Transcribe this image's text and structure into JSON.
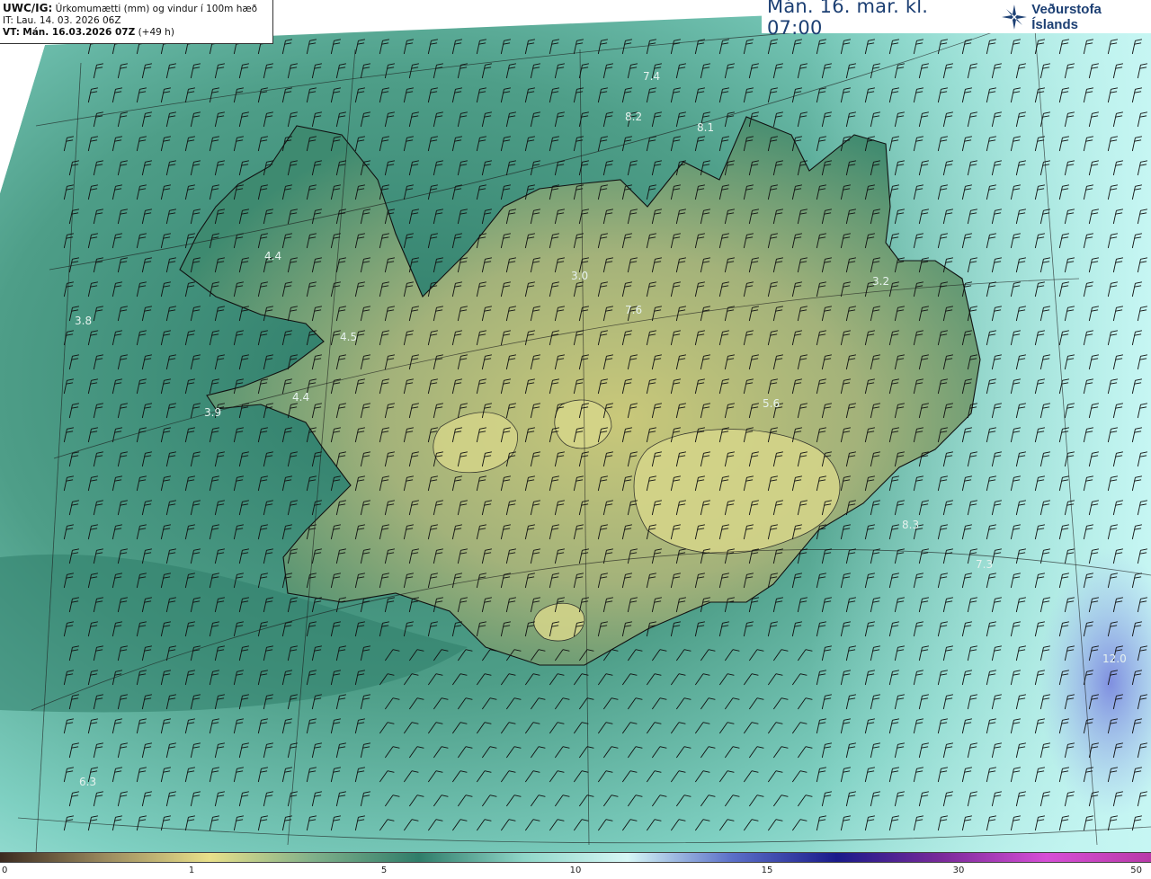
{
  "header": {
    "title_prefix": "UWC/IG:",
    "title_rest": " Úrkomumætti (mm) og vindur í 100m hæð",
    "initial_time": "IT: Lau. 14. 03. 2026 06Z",
    "valid_prefix": "VT:",
    "valid_time": "Mán. 16.03.2026 07Z",
    "lead": "(+49 h)",
    "date_display": "Mán. 16. mar. kl. 07:00",
    "brand": "Veðurstofa Íslands"
  },
  "colors": {
    "land_low": "#2f7d6a",
    "land_high": "#c9c87a",
    "sea": "#7fd0c2",
    "sea_light": "#b9efe9",
    "coast": "#111111",
    "brand": "#1c3f73"
  },
  "icons": {
    "logo": "star-wind-icon"
  },
  "colorbar": {
    "ticks": [
      "0",
      "1",
      "5",
      "10",
      "15",
      "30",
      "50"
    ],
    "stops": [
      "#3b2a1f",
      "#9b8a5e",
      "#e8e08a",
      "#7fb08a",
      "#2f7d6a",
      "#8fd6c8",
      "#d6f7f6",
      "#5b6fc8",
      "#1a1a8a",
      "#7a2a9a",
      "#d64ed6",
      "#b83aa8"
    ]
  },
  "precip_labels": [
    "7.4",
    "8.2",
    "8.1",
    "4.4",
    "3.0",
    "3.2",
    "3.8",
    "4.5",
    "7.6",
    "4.4",
    "3.9",
    "5.6",
    "8.3",
    "7.3",
    "12.0",
    "6.3"
  ]
}
